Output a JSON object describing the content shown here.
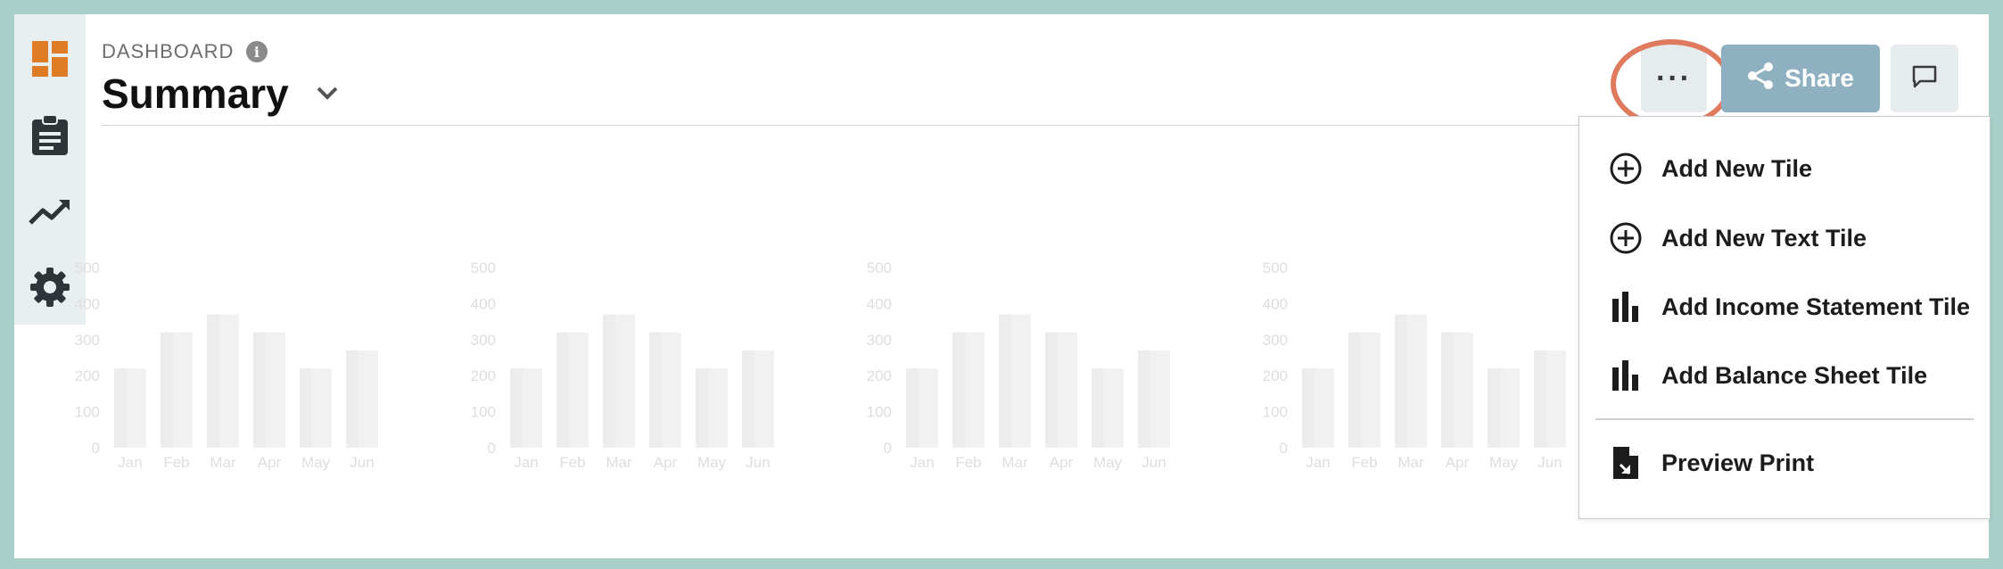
{
  "header": {
    "section_label": "DASHBOARD",
    "info_symbol": "i",
    "title": "Summary"
  },
  "toolbar": {
    "more_label": "···",
    "share_label": "Share"
  },
  "sidebar": {
    "items": [
      {
        "icon": "dashboard-grid-icon",
        "color": "#e07b26"
      },
      {
        "icon": "clipboard-icon",
        "color": "#2f3439"
      },
      {
        "icon": "trend-up-icon",
        "color": "#2f3439"
      },
      {
        "icon": "gear-icon",
        "color": "#2f3439"
      }
    ]
  },
  "menu": {
    "items": [
      {
        "label": "Add New Tile",
        "icon": "plus-circle-icon"
      },
      {
        "label": "Add New Text Tile",
        "icon": "plus-circle-icon"
      },
      {
        "label": "Add Income Statement Tile",
        "icon": "bar-chart-icon"
      },
      {
        "label": "Add Balance Sheet Tile",
        "icon": "bar-chart-icon"
      },
      {
        "label": "Preview Print",
        "icon": "document-export-icon"
      }
    ]
  },
  "chart_data": [
    {
      "type": "bar",
      "categories": [
        "Jan",
        "Feb",
        "Mar",
        "Apr",
        "May",
        "Jun"
      ],
      "values": [
        220,
        320,
        370,
        320,
        220,
        270
      ],
      "yticks": [
        0,
        100,
        200,
        300,
        400,
        500
      ],
      "ylim": [
        0,
        500
      ],
      "grid": false
    },
    {
      "type": "bar",
      "categories": [
        "Jan",
        "Feb",
        "Mar",
        "Apr",
        "May",
        "Jun"
      ],
      "values": [
        220,
        320,
        370,
        320,
        220,
        270
      ],
      "yticks": [
        0,
        100,
        200,
        300,
        400,
        500
      ],
      "ylim": [
        0,
        500
      ],
      "grid": false
    },
    {
      "type": "bar",
      "categories": [
        "Jan",
        "Feb",
        "Mar",
        "Apr",
        "May",
        "Jun"
      ],
      "values": [
        220,
        320,
        370,
        320,
        220,
        270
      ],
      "yticks": [
        0,
        100,
        200,
        300,
        400,
        500
      ],
      "ylim": [
        0,
        500
      ],
      "grid": false
    },
    {
      "type": "bar",
      "categories": [
        "Jan",
        "Feb",
        "Mar",
        "Apr",
        "May",
        "Jun"
      ],
      "values": [
        220,
        320,
        370,
        320,
        220,
        270
      ],
      "yticks": [
        0,
        100,
        200,
        300,
        400,
        500
      ],
      "ylim": [
        0,
        500
      ],
      "grid": false
    }
  ]
}
